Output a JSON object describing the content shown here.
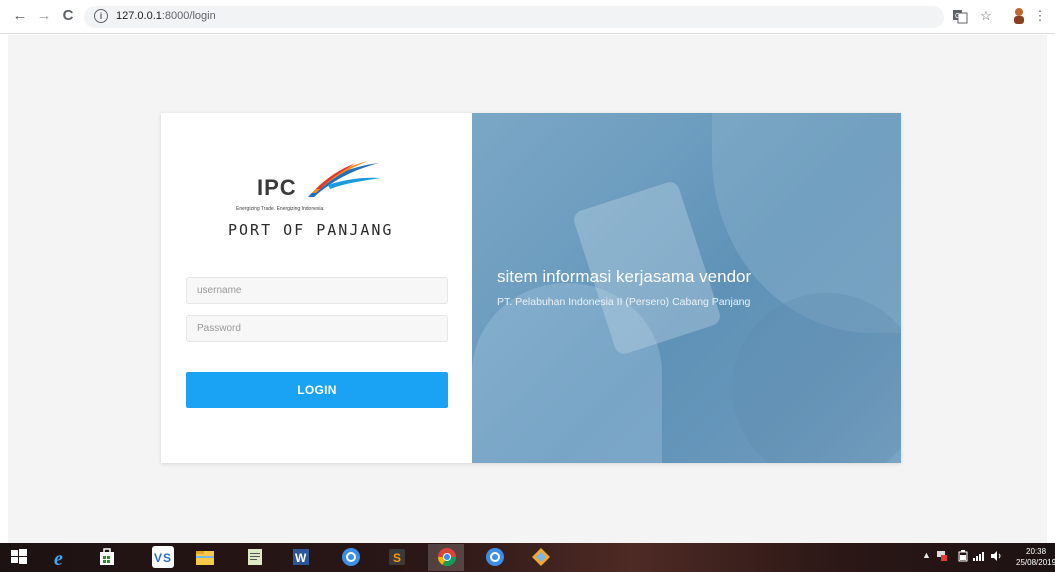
{
  "browser": {
    "url_host": "127.0.0.1",
    "url_path": ":8000/login",
    "back_icon": "←",
    "forward_icon": "→",
    "reload_icon": "C",
    "info_icon": "i",
    "translate_icon": "translate-icon",
    "star_icon": "☆",
    "menu_icon": "⋮"
  },
  "logo": {
    "brand": "IPC",
    "tagline": "Energizing Trade. Energizing Indonesia.",
    "subtitle": "PORT OF PANJANG"
  },
  "form": {
    "username_placeholder": "username",
    "password_placeholder": "Password",
    "login_label": "LOGIN"
  },
  "hero": {
    "title": "sitem informasi kerjasama vendor",
    "subtitle": "PT. Pelabuhan Indonesia II (Persero) Cabang Panjang"
  },
  "taskbar": {
    "time": "20:38",
    "date": "25/08/2019"
  },
  "colors": {
    "login_button": "#1aa3f5",
    "hero_panel": "#6d9dbf",
    "page_bg": "#f4f4f4"
  }
}
